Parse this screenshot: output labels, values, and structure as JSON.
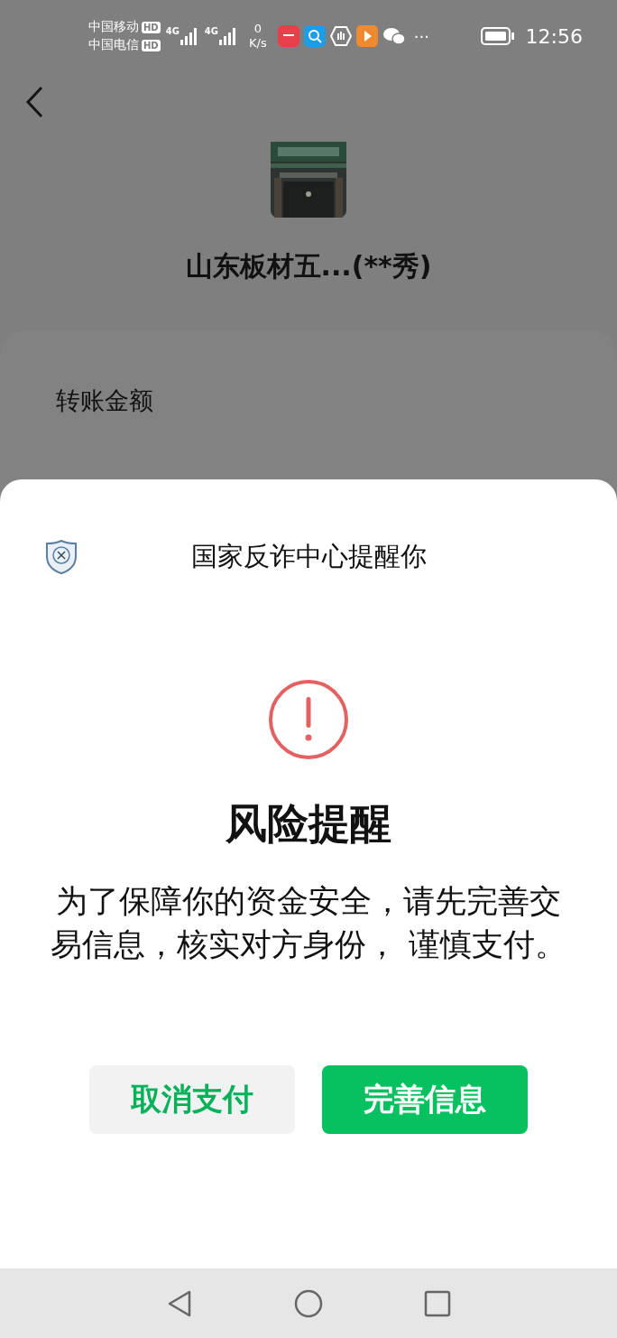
{
  "status_bar": {
    "carriers": [
      {
        "name": "中国移动",
        "badge": "HD"
      },
      {
        "name": "中国电信",
        "badge": "HD"
      }
    ],
    "network_labels": [
      "4G",
      "4G"
    ],
    "speed_value": "0",
    "speed_unit": "K/s",
    "more": "···",
    "time": "12:56"
  },
  "payee": {
    "name": "山东板材五...(**秀)"
  },
  "transfer": {
    "label": "转账金额"
  },
  "alert": {
    "source": "国家反诈中心提醒你",
    "title": "风险提醒",
    "message": "为了保障你的资金安全，请先完善交易信息，核实对方身份， 谨慎支付。",
    "buttons": [
      {
        "label": "取消支付",
        "kind": "secondary"
      },
      {
        "label": "完善信息",
        "kind": "primary"
      }
    ]
  }
}
